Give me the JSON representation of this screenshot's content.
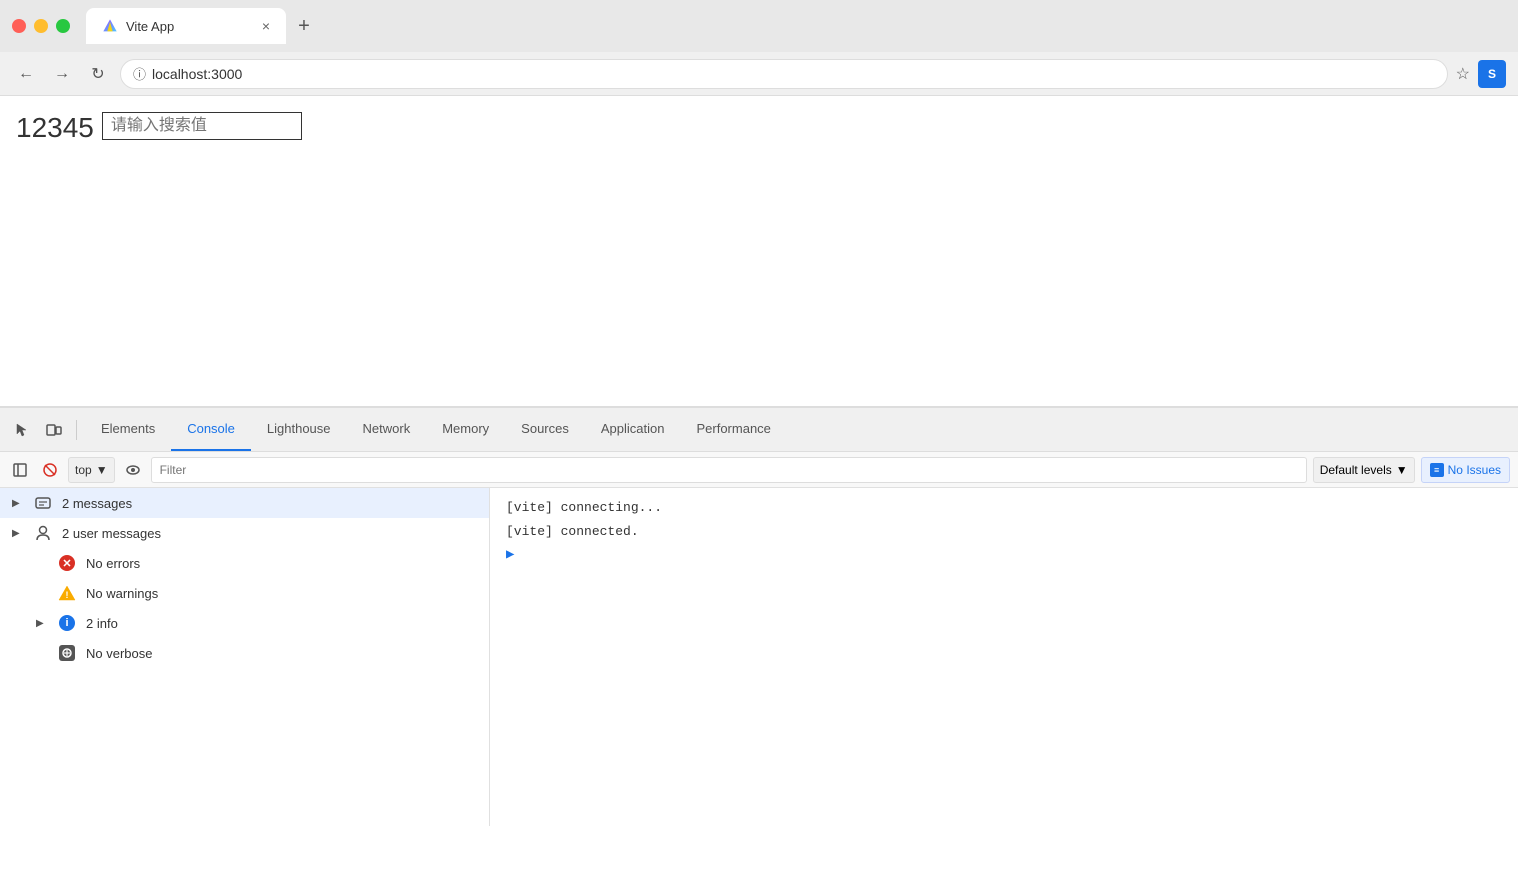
{
  "browser": {
    "traffic_lights": [
      "red",
      "yellow",
      "green"
    ],
    "tab": {
      "title": "Vite App",
      "close_label": "×"
    },
    "new_tab_label": "+",
    "nav": {
      "back_label": "←",
      "forward_label": "→",
      "reload_label": "↻",
      "url": "localhost:3000",
      "bookmark_label": "☆"
    }
  },
  "page": {
    "number": "12345",
    "search_placeholder": "请输入搜索值"
  },
  "devtools": {
    "toolbar": {
      "inspect_label": "⊹",
      "device_label": "⧉",
      "tabs": [
        {
          "id": "elements",
          "label": "Elements",
          "active": false
        },
        {
          "id": "console",
          "label": "Console",
          "active": true
        },
        {
          "id": "lighthouse",
          "label": "Lighthouse",
          "active": false
        },
        {
          "id": "network",
          "label": "Network",
          "active": false
        },
        {
          "id": "memory",
          "label": "Memory",
          "active": false
        },
        {
          "id": "sources",
          "label": "Sources",
          "active": false
        },
        {
          "id": "application",
          "label": "Application",
          "active": false
        },
        {
          "id": "performance",
          "label": "Performance",
          "active": false
        }
      ]
    },
    "console_bar": {
      "clear_label": "🚫",
      "sidebar_label": "⊞",
      "context": "top",
      "eye_label": "👁",
      "filter_placeholder": "Filter",
      "levels_label": "Default levels",
      "no_issues_label": "No Issues"
    },
    "filters": [
      {
        "id": "messages",
        "expand": true,
        "icon": "messages",
        "label": "2 messages",
        "indent": false,
        "highlighted": true
      },
      {
        "id": "user-messages",
        "expand": true,
        "icon": "user",
        "label": "2 user messages",
        "indent": false,
        "highlighted": false
      },
      {
        "id": "no-errors",
        "expand": false,
        "icon": "error",
        "label": "No errors",
        "indent": true,
        "highlighted": false
      },
      {
        "id": "no-warnings",
        "expand": false,
        "icon": "warning",
        "label": "No warnings",
        "indent": true,
        "highlighted": false
      },
      {
        "id": "2-info",
        "expand": true,
        "icon": "info",
        "label": "2 info",
        "indent": true,
        "highlighted": false
      },
      {
        "id": "no-verbose",
        "expand": false,
        "icon": "verbose",
        "label": "No verbose",
        "indent": true,
        "highlighted": false
      }
    ],
    "console_output": [
      {
        "text": "[vite] connecting...",
        "type": "normal"
      },
      {
        "text": "[vite] connected.",
        "type": "normal"
      }
    ]
  }
}
